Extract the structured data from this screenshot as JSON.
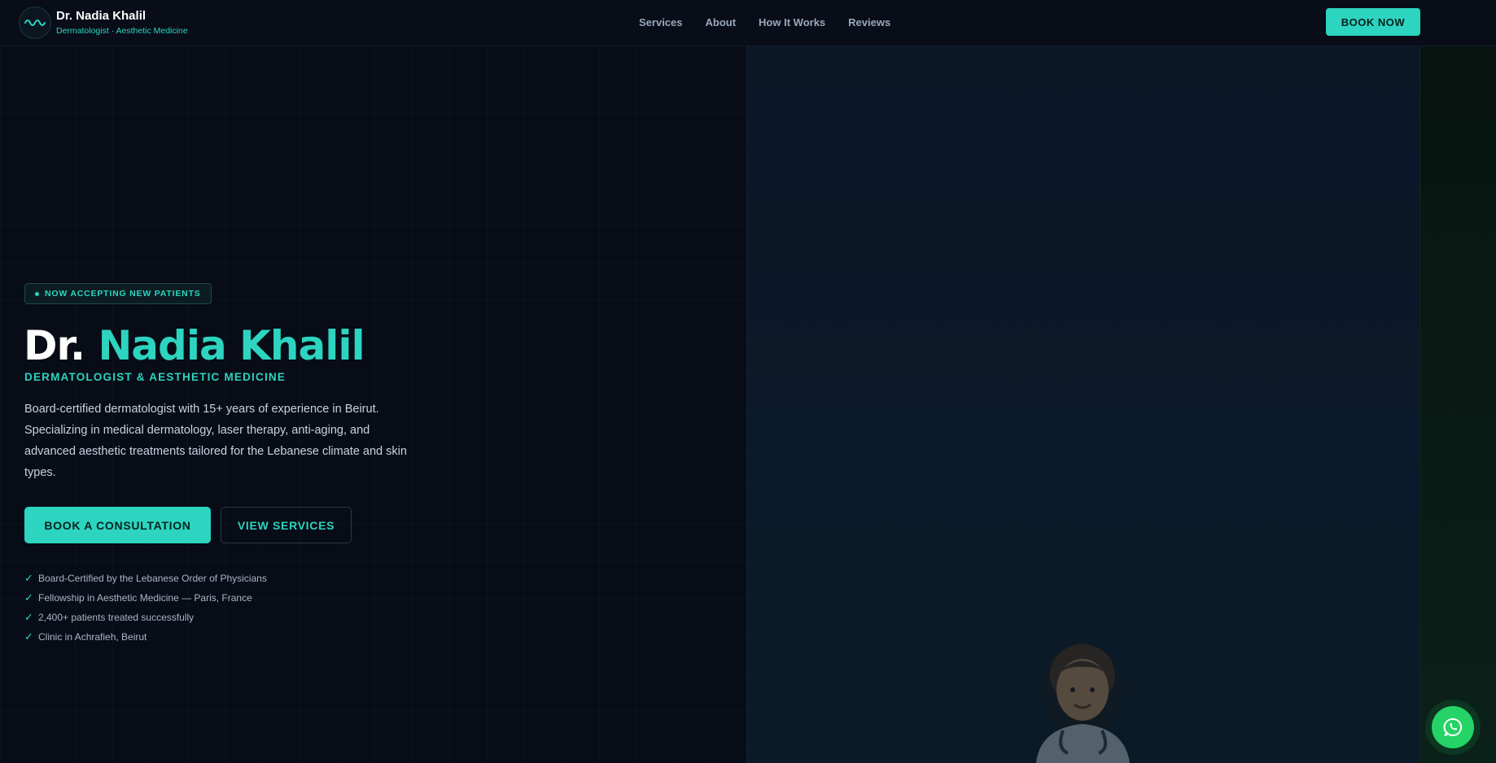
{
  "brand": {
    "name": "Dr. Nadia Khalil",
    "tagline": "Dermatologist · Aesthetic Medicine",
    "logo_icon": "wave-icon"
  },
  "nav": {
    "items": [
      "Services",
      "About",
      "How It Works",
      "Reviews"
    ],
    "cta_label": "BOOK NOW"
  },
  "hero": {
    "badge": "NOW ACCEPTING NEW PATIENTS",
    "title_prefix": "Dr.",
    "title_name": "Nadia Khalil",
    "subtitle": "DERMATOLOGIST & AESTHETIC MEDICINE",
    "description": "Board-certified dermatologist with 15+ years of experience in Beirut. Specializing in medical dermatology, laser therapy, anti-aging, and advanced aesthetic treatments tailored for the Lebanese climate and skin types.",
    "primary_button": "BOOK A CONSULTATION",
    "secondary_button": "VIEW SERVICES",
    "credentials": [
      "Board-Certified by the Lebanese Order of Physicians",
      "Fellowship in Aesthetic Medicine — Paris, France",
      "2,400+ patients treated successfully",
      "Clinic in Achrafieh, Beirut"
    ],
    "check_glyph": "✓",
    "portrait_icon": "doctor-emoji-icon"
  },
  "floating": {
    "whatsapp_icon": "whatsapp-icon"
  },
  "colors": {
    "accent": "#2dd4bf",
    "background": "#070c16",
    "whatsapp": "#25d366"
  }
}
